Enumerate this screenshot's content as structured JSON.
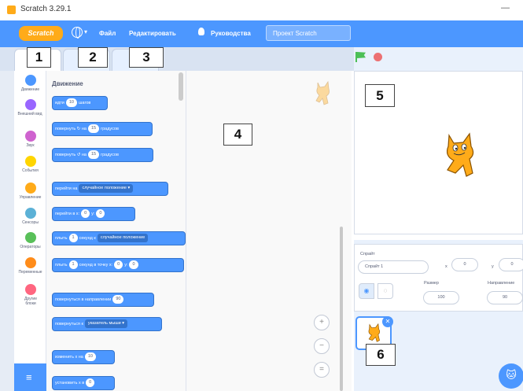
{
  "window": {
    "title": "Scratch 3.29.1",
    "minimize_glyph": "—"
  },
  "menubar": {
    "logo": "Scratch",
    "language_icon": "globe-icon",
    "file": "Файл",
    "edit": "Редактировать",
    "tutorials": "Руководства",
    "project_title": "Проект Scratch"
  },
  "callouts": {
    "c1": "1",
    "c2": "2",
    "c3": "3",
    "c4": "4",
    "c5": "5",
    "c6": "6"
  },
  "categories": [
    {
      "label": "Движение",
      "color": "#4c97ff"
    },
    {
      "label": "Внешний вид",
      "color": "#9966ff"
    },
    {
      "label": "Звук",
      "color": "#cf63cf"
    },
    {
      "label": "События",
      "color": "#ffd500"
    },
    {
      "label": "Управление",
      "color": "#ffab19"
    },
    {
      "label": "Сенсоры",
      "color": "#5cb1d6"
    },
    {
      "label": "Операторы",
      "color": "#59c059"
    },
    {
      "label": "Переменные",
      "color": "#ff8c1a"
    },
    {
      "label": "Другие блоки",
      "color": "#ff6680"
    }
  ],
  "palette": {
    "section_title": "Движение",
    "blocks": {
      "move": {
        "a": "идти",
        "v1": "10",
        "b": "шагов"
      },
      "turn_right": {
        "a": "повернуть",
        "v1": "15",
        "b": "градусов"
      },
      "turn_left": {
        "a": "повернуть",
        "v1": "15",
        "b": "градусов"
      },
      "goto": {
        "a": "перейти на",
        "d1": "случайное положение ▾"
      },
      "goto_xy": {
        "a": "перейти в x:",
        "v1": "0",
        "b": "y:",
        "v2": "0"
      },
      "glide_to": {
        "a": "плыть",
        "v1": "1",
        "b": "секунд к",
        "d1": "случайное положение"
      },
      "glide_xy": {
        "a": "плыть",
        "v1": "1",
        "b": "секунд в точку x:",
        "v2": "0",
        "c": "y:",
        "v3": "0"
      },
      "point_dir": {
        "a": "повернуться в направлении",
        "v1": "90"
      },
      "point_towards": {
        "a": "повернуться к",
        "d1": "указатель мыши ▾"
      },
      "change_x": {
        "a": "изменить х на",
        "v1": "10"
      },
      "set_x": {
        "a": "установить х в",
        "v1": "0"
      }
    }
  },
  "code_area": {
    "zoom_in": "+",
    "zoom_out": "−",
    "zoom_reset": "="
  },
  "sprite_info": {
    "sprite_label": "Спрайт",
    "sprite_name": "Спрайт 1",
    "x_label": "x",
    "x_value": "0",
    "y_label": "y",
    "y_value": "0",
    "size_label": "Размер",
    "size_value": "100",
    "direction_label": "Направление",
    "direction_value": "90"
  },
  "colors": {
    "menu_blue": "#4c97ff",
    "motion_blue": "#4c97ff",
    "flag_green": "#4cbf56",
    "stop_red": "#ec5959"
  }
}
